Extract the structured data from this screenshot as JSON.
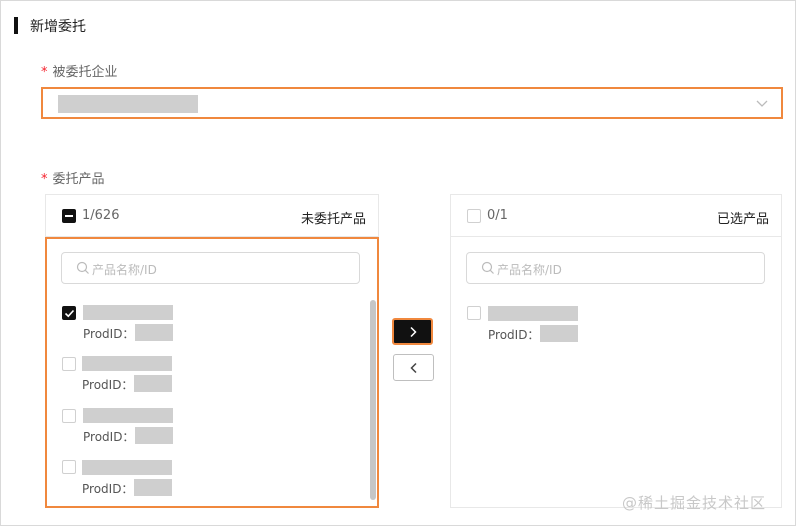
{
  "header": {
    "title": "新增委托"
  },
  "enterprise_field": {
    "required_mark": "*",
    "label": "被委托企业",
    "value_masked": true
  },
  "products_field": {
    "required_mark": "*",
    "label": "委托产品"
  },
  "left_panel": {
    "count": "1/626",
    "title": "未委托产品",
    "search_placeholder": "产品名称/ID",
    "items": [
      {
        "pid_label": "ProdID：",
        "checked": true
      },
      {
        "pid_label": "ProdID：",
        "checked": false
      },
      {
        "pid_label": "ProdID：",
        "checked": false
      },
      {
        "pid_label": "ProdID：",
        "checked": false
      }
    ]
  },
  "right_panel": {
    "count": "0/1",
    "title": "已选产品",
    "search_placeholder": "产品名称/ID",
    "items": [
      {
        "pid_label": "ProdID：",
        "checked": false
      }
    ]
  },
  "transfer": {
    "move_right_icon": "chevron-right-icon",
    "move_left_icon": "chevron-left-icon"
  },
  "colors": {
    "highlight": "#f0883e",
    "accent": "#111111",
    "mask": "#cfcfcf"
  },
  "watermark": "@稀土掘金技术社区"
}
